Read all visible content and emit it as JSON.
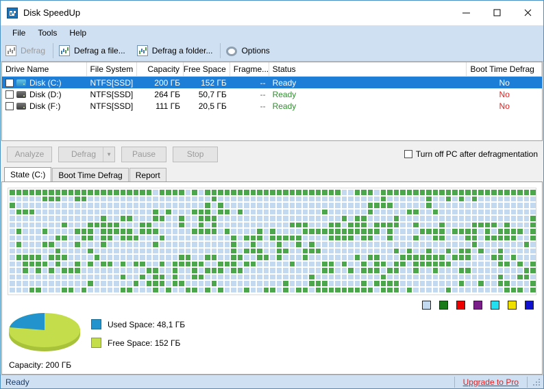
{
  "window": {
    "title": "Disk SpeedUp",
    "icon": "app-icon",
    "minimize": "—",
    "maximize": "□",
    "close": "✕"
  },
  "menu": {
    "items": [
      "File",
      "Tools",
      "Help"
    ]
  },
  "toolbar": {
    "items": [
      {
        "label": "Defrag",
        "icon": "defrag-icon",
        "disabled": true
      },
      {
        "label": "Defrag a file...",
        "icon": "defrag-file-icon",
        "disabled": false
      },
      {
        "label": "Defrag a folder...",
        "icon": "defrag-folder-icon",
        "disabled": false
      },
      {
        "label": "Options",
        "icon": "gear-icon",
        "disabled": false
      }
    ]
  },
  "drive_table": {
    "columns": [
      "Drive Name",
      "File System",
      "Capacity",
      "Free Space",
      "Fragme...",
      "Status",
      "",
      "Boot Time Defrag"
    ],
    "rows": [
      {
        "name": "Disk (C:)",
        "fs": "NTFS[SSD]",
        "capacity": "200 ГБ",
        "free": "152 ГБ",
        "frag": "--",
        "status": "Ready",
        "boot": "No",
        "selected": true
      },
      {
        "name": "Disk (D:)",
        "fs": "NTFS[SSD]",
        "capacity": "264 ГБ",
        "free": "50,7 ГБ",
        "frag": "--",
        "status": "Ready",
        "boot": "No",
        "selected": false
      },
      {
        "name": "Disk (F:)",
        "fs": "NTFS[SSD]",
        "capacity": "111 ГБ",
        "free": "20,5 ГБ",
        "frag": "--",
        "status": "Ready",
        "boot": "No",
        "selected": false
      }
    ]
  },
  "actions": {
    "analyze": "Analyze",
    "defrag": "Defrag",
    "pause": "Pause",
    "stop": "Stop",
    "turn_off_label": "Turn off PC after defragmentation",
    "turn_off_checked": false
  },
  "tabs": [
    {
      "label": "State (C:)",
      "active": true
    },
    {
      "label": "Boot Time Defrag",
      "active": false
    },
    {
      "label": "Report",
      "active": false
    }
  ],
  "map": {
    "colors": {
      "used": "#4CA64C",
      "free": "#C3D9F0"
    },
    "swatches": [
      "#C3D9F0",
      "#1a7a1a",
      "#ee0000",
      "#7a1f8a",
      "#22e0f0",
      "#f0e000",
      "#1010d0"
    ]
  },
  "chart_data": {
    "type": "pie",
    "title": "",
    "labels": [
      "Used Space",
      "Free Space"
    ],
    "values": [
      48.1,
      152
    ],
    "value_labels": [
      "48,1 ГБ",
      "152 ГБ"
    ],
    "legend": [
      "Used Space: 48,1 ГБ",
      "Free Space: 152 ГБ"
    ],
    "colors": [
      "#2293cc",
      "#c3de4a"
    ],
    "legend_position": "right",
    "capacity_label": "Capacity: 200 ГБ",
    "total": 200,
    "unit": "ГБ"
  },
  "status": {
    "text": "Ready",
    "upgrade": "Upgrade to Pro"
  }
}
